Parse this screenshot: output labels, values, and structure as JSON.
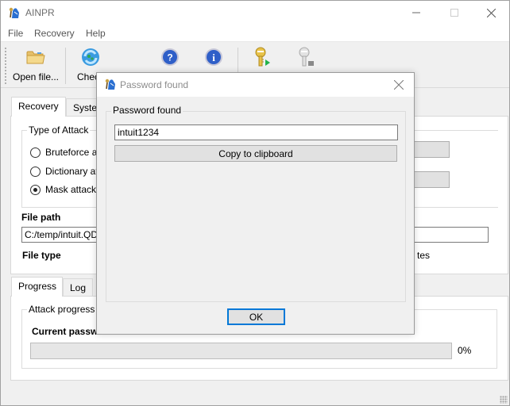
{
  "window": {
    "title": "AINPR",
    "controls": {
      "minimize": "minimize-icon",
      "maximize": "maximize-icon",
      "close": "close-icon"
    }
  },
  "menu": {
    "items": [
      "File",
      "Recovery",
      "Help"
    ]
  },
  "toolbar": {
    "buttons": [
      {
        "label": "Open file...",
        "icon": "folder-icon"
      },
      {
        "label": "Check",
        "icon": "refresh-icon"
      },
      {
        "label": "",
        "icon": "help-icon"
      },
      {
        "label": "",
        "icon": "info-icon"
      },
      {
        "label": "",
        "icon": "key-start-icon"
      },
      {
        "label": "",
        "icon": "key-stop-icon"
      }
    ]
  },
  "top_tabs": {
    "items": [
      "Recovery",
      "Syste"
    ],
    "active": 0
  },
  "recovery": {
    "attack_group_title": "Type of Attack",
    "attack_options": [
      {
        "label": "Bruteforce at",
        "checked": false
      },
      {
        "label": "Dictionary att",
        "checked": false
      },
      {
        "label": "Mask attack",
        "checked": true
      }
    ],
    "file_path_label": "File path",
    "file_path_value": "C:/temp/intuit.QDF",
    "file_type_label": "File type",
    "file_size_fragment": "tes"
  },
  "bottom_tabs": {
    "items": [
      "Progress",
      "Log"
    ],
    "active": 0
  },
  "progress": {
    "group_title": "Attack progress",
    "current_password_label": "Current passw",
    "percent": 0,
    "percent_text": "0%"
  },
  "dialog": {
    "title": "Password found",
    "group_title": "Password found",
    "password_value": "intuit1234",
    "copy_button": "Copy to clipboard",
    "ok_button": "OK"
  },
  "colors": {
    "accent": "#0078d7",
    "window_bg": "#f0f0f0",
    "progress_fill": "#06b025"
  }
}
